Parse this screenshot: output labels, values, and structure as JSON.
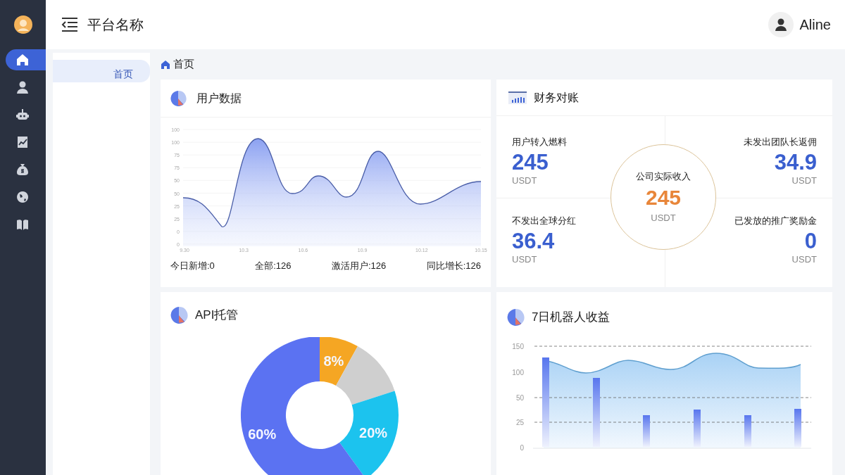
{
  "sidebar": {
    "items": [
      {
        "kind": "home",
        "selected": true
      },
      {
        "kind": "user",
        "selected": false
      },
      {
        "kind": "robot",
        "selected": false
      },
      {
        "kind": "chart",
        "selected": false
      },
      {
        "kind": "money",
        "selected": false
      },
      {
        "kind": "globe",
        "selected": false
      },
      {
        "kind": "book",
        "selected": false
      }
    ]
  },
  "header": {
    "title": "平台名称",
    "user": "Aline"
  },
  "subnav": {
    "items": [
      {
        "label": "首页",
        "selected": true
      }
    ]
  },
  "breadcrumb": "首页",
  "user_card": {
    "title": "用户数据",
    "y_axis_labels": [
      "100",
      "100",
      "75",
      "75",
      "50",
      "50",
      "25",
      "25",
      "0",
      "0"
    ],
    "x_axis_labels": [
      "9.30",
      "10.3",
      "10.6",
      "10.9",
      "10.12",
      "10.15"
    ],
    "stats": [
      "今日新增:0",
      "全部:126",
      "激活用户:126",
      "同比增长:126"
    ]
  },
  "finance": {
    "title": "财务对账",
    "cells": [
      {
        "label": "用户转入燃料",
        "value": "245",
        "unit": "USDT"
      },
      {
        "label": "未发出团队长返佣",
        "value": "34.9",
        "unit": "USDT"
      },
      {
        "label": "不发出全球分红",
        "value": "36.4",
        "unit": "USDT"
      },
      {
        "label": "已发放的推广奖励金",
        "value": "0",
        "unit": "USDT"
      }
    ],
    "center": {
      "label": "公司实际收入",
      "value": "245",
      "unit": "USDT"
    }
  },
  "api_card": {
    "title": "API托管",
    "chart_data": {
      "type": "donut",
      "values": [
        8,
        12,
        20,
        60
      ],
      "value_labels": [
        "8%",
        null,
        "20%",
        "60%"
      ],
      "colors": [
        "#f5a623",
        "#cfcfcf",
        "#1cc3ee",
        "#5b72f2"
      ]
    }
  },
  "robot_card": {
    "title": "7日机器人收益",
    "y_axis_labels": [
      "150",
      "100",
      "50",
      "25",
      "0"
    ]
  }
}
